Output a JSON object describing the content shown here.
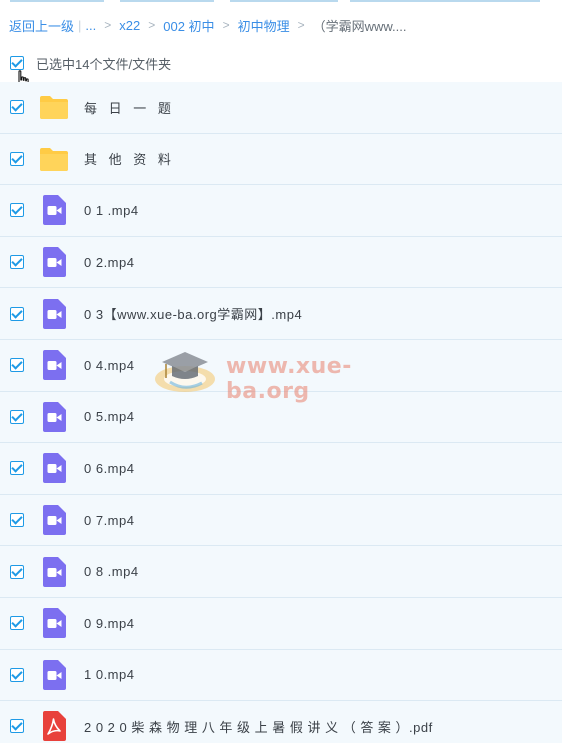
{
  "breadcrumb": {
    "back": "返回上一级",
    "ellipsis": "...",
    "items": [
      "x22",
      "002 初中",
      "初中物理"
    ],
    "current": "（学霸网www...."
  },
  "selection": {
    "label": "已选中14个文件/文件夹"
  },
  "files": [
    {
      "name": "每 日 一 题",
      "type": "folder"
    },
    {
      "name": "其 他 资 料",
      "type": "folder"
    },
    {
      "name": "0 1 .mp4",
      "type": "video"
    },
    {
      "name": "0 2.mp4",
      "type": "video"
    },
    {
      "name": "0 3【www.xue-ba.org学霸网】.mp4",
      "type": "video"
    },
    {
      "name": "0 4.mp4",
      "type": "video"
    },
    {
      "name": "0 5.mp4",
      "type": "video"
    },
    {
      "name": "0 6.mp4",
      "type": "video"
    },
    {
      "name": "0 7.mp4",
      "type": "video"
    },
    {
      "name": "0 8 .mp4",
      "type": "video"
    },
    {
      "name": "0 9.mp4",
      "type": "video"
    },
    {
      "name": "1 0.mp4",
      "type": "video"
    },
    {
      "name": "2 0 2 0 柴 森 物 理 八 年 级 上 暑 假 讲 义 （ 答 案 ）.pdf",
      "type": "pdf"
    }
  ],
  "watermark": {
    "text": "www.xue-ba.org"
  },
  "colors": {
    "accent": "#1e9ae6",
    "link": "#3a8ee6",
    "row_bg": "#f3f9fd",
    "folder": "#ffcb45",
    "video": "#7c6ff0",
    "pdf": "#e8413b"
  }
}
